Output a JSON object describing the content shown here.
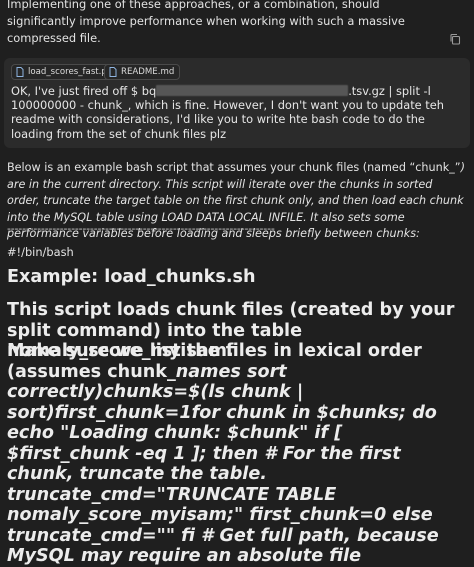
{
  "intro": "Implementing one of these approaches, or a combination, should significantly improve performance when working with such a massive compressed file.",
  "user_message": {
    "attachments": [
      "load_scores_fast.py",
      "README.md"
    ],
    "text_before_redaction": "OK, I've just fired off $ bq",
    "text_after_redaction": ".tsv.gz | split -l 100000000 - chunk_, which is fine. However, I don't want you to update teh readme with considerations, I'd like you to write hte bash code to do the loading from the set of chunk files plz"
  },
  "response": {
    "lead": "Below is an example bash script that assumes your chunk files (named “chunk_”",
    "lead_italic": ") are in the current directory. This script will iterate over the chunks in sorted order, truncate the target table on the first chunk only, and then load each chunk into the MySQL table using LOAD DATA LOCAL INFILE. It also sets some performance variables before loading and sleeps briefly between chunks:",
    "dashes": "-----------------------------------------------------------------------",
    "shebang": "#!/bin/bash",
    "heading_example": "Example: load_chunks.sh",
    "heading_description": "This script loads chunk files (created by your split command) into the table nomaly_score_myisam.",
    "heading_long_a": "Make sure we list the files in lexical order (assumes chunk_",
    "heading_long_b": "names sort correctly)",
    "heading_long_c": "chunks=$(ls chunk | sort)first_chunk=1for chunk in $chunks; do echo \"Loading chunk: $chunk\" if [ $first_chunk -eq 1 ]; then # For the first chunk, truncate the table. truncate_cmd=\"TRUNCATE TABLE nomaly_score_myisam;\" first_chunk=0 else truncate_cmd=\"\" fi # Get full path, because MySQL may require an absolute file"
  }
}
